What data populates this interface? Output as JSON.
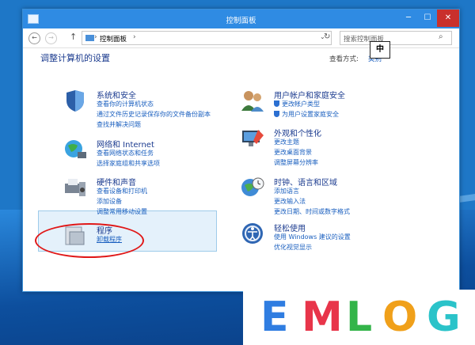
{
  "window": {
    "title": "控制面板"
  },
  "titlebar": {
    "minimize_icon": "minimize-icon",
    "maximize_icon": "maximize-icon",
    "close_icon": "close-icon"
  },
  "nav": {
    "crumb": "控制面板",
    "sep": "›",
    "search_placeholder": "搜索控制面板"
  },
  "main": {
    "heading": "调整计算机的设置",
    "view_by_label": "查看方式:",
    "view_by_value": "类别"
  },
  "ime_indicator": "中",
  "categories": [
    {
      "title": "系统和安全",
      "links": [
        "查看你的计算机状态",
        "通过文件历史记录保存你的文件备份副本",
        "查找并解决问题"
      ]
    },
    {
      "title": "网络和 Internet",
      "links": [
        "查看网络状态和任务",
        "选择家庭组和共享选项"
      ]
    },
    {
      "title": "硬件和声音",
      "links": [
        "查看设备和打印机",
        "添加设备",
        "调整常用移动设置"
      ]
    },
    {
      "title": "程序",
      "links": [
        "卸载程序"
      ]
    },
    {
      "title": "用户帐户和家庭安全",
      "links": [
        "更改帐户类型",
        "为用户设置家庭安全"
      ]
    },
    {
      "title": "外观和个性化",
      "links": [
        "更改主题",
        "更改桌面背景",
        "调整屏幕分辨率"
      ]
    },
    {
      "title": "时钟、语言和区域",
      "links": [
        "添加语言",
        "更改输入法",
        "更改日期、时间或数字格式"
      ]
    },
    {
      "title": "轻松使用",
      "links": [
        "使用 Windows 建议的设置",
        "优化视觉显示"
      ]
    }
  ],
  "watermark": {
    "letters": [
      "E",
      "M",
      "L",
      "O",
      "G"
    ],
    "colors": [
      "#2f7de1",
      "#e8354a",
      "#33b449",
      "#f0a01a",
      "#2bc3c9"
    ]
  }
}
